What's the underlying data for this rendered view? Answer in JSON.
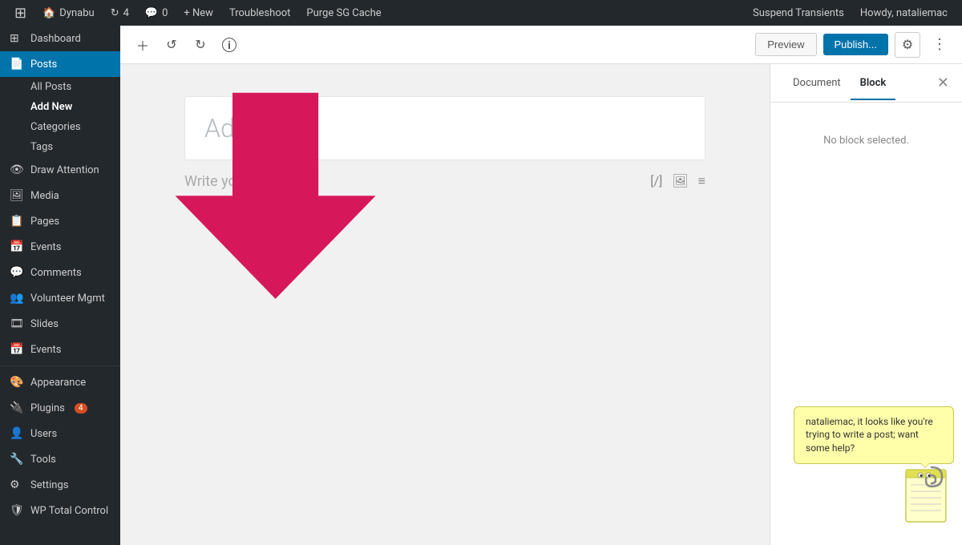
{
  "adminbar": {
    "wp_logo": "⊞",
    "site_name": "Dynabu",
    "updates_count": "4",
    "comments_icon_label": "Comments",
    "comments_count": "0",
    "new_label": "+ New",
    "troubleshoot_label": "Troubleshoot",
    "purge_cache_label": "Purge SG Cache",
    "suspend_transients_label": "Suspend Transients",
    "howdy_label": "Howdy, nataliemac"
  },
  "sidebar": {
    "dashboard_label": "Dashboard",
    "posts_label": "Posts",
    "all_posts_label": "All Posts",
    "add_new_label": "Add New",
    "categories_label": "Categories",
    "tags_label": "Tags",
    "draw_attention_label": "Draw Attention",
    "media_label": "Media",
    "pages_label": "Pages",
    "events_label": "Events",
    "comments_label": "Comments",
    "volunteer_mgmt_label": "Volunteer Mgmt",
    "slides_label": "Slides",
    "events2_label": "Events",
    "appearance_label": "Appearance",
    "plugins_label": "Plugins",
    "plugins_badge": "4",
    "users_label": "Users",
    "tools_label": "Tools",
    "settings_label": "Settings",
    "wp_total_control_label": "WP Total Control"
  },
  "toolbar": {
    "add_label": "+",
    "undo_label": "↺",
    "redo_label": "↻",
    "info_label": "ℹ",
    "preview_label": "Preview",
    "publish_label": "Publish..."
  },
  "editor": {
    "title_placeholder": "Add t",
    "body_placeholder": "Write your story"
  },
  "right_panel": {
    "document_tab": "Document",
    "block_tab": "Block",
    "no_block_message": "No block selected."
  },
  "clippy": {
    "message": "nataliemac, it looks like you're trying to write a post; want some help?"
  },
  "colors": {
    "accent": "#0073aa",
    "arrow": "#d6185a",
    "adminbar_bg": "#23282d",
    "sidebar_bg": "#23282d",
    "sidebar_active": "#0073aa"
  }
}
